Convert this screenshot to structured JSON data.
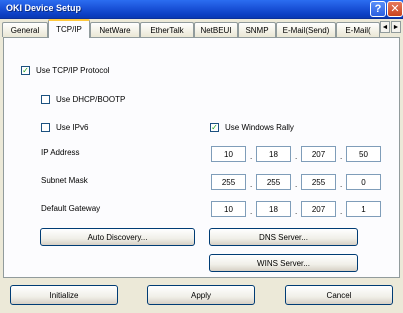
{
  "window": {
    "title": "OKI Device Setup",
    "help_glyph": "?",
    "close_glyph": "✕"
  },
  "tabs": [
    {
      "label": "General"
    },
    {
      "label": "TCP/IP",
      "active": true
    },
    {
      "label": "NetWare"
    },
    {
      "label": "EtherTalk"
    },
    {
      "label": "NetBEUI"
    },
    {
      "label": "SNMP"
    },
    {
      "label": "E-Mail(Send)"
    },
    {
      "label": "E-Mail("
    }
  ],
  "tab_scroll": {
    "left": "◄",
    "right": "►"
  },
  "checkboxes": {
    "use_tcpip": {
      "label": "Use TCP/IP Protocol",
      "checked": true,
      "mark": "✓"
    },
    "use_dhcp": {
      "label": "Use DHCP/BOOTP",
      "checked": false,
      "mark": ""
    },
    "use_ipv6": {
      "label": "Use IPv6",
      "checked": false,
      "mark": ""
    },
    "use_rally": {
      "label": "Use Windows Rally",
      "checked": true,
      "mark": "✓"
    }
  },
  "fields": {
    "ip_address": {
      "label": "IP Address",
      "octets": [
        "10",
        "18",
        "207",
        "50"
      ]
    },
    "subnet_mask": {
      "label": "Subnet Mask",
      "octets": [
        "255",
        "255",
        "255",
        "0"
      ]
    },
    "default_gateway": {
      "label": "Default Gateway",
      "octets": [
        "10",
        "18",
        "207",
        "1"
      ]
    },
    "dot": "."
  },
  "buttons": {
    "auto_discovery": "Auto Discovery...",
    "dns_server": "DNS Server...",
    "wins_server": "WINS Server..."
  },
  "footer": {
    "initialize": "Initialize",
    "apply": "Apply",
    "cancel": "Cancel"
  },
  "colors": {
    "title_bar": "#0c3fc4",
    "dialog_bg": "#ece9d8",
    "panel_bg": "#fcfcfe",
    "active_tab_accent": "#ffc83c",
    "check_mark": "#21a121"
  },
  "icons": {
    "help": "help-icon",
    "close": "close-icon",
    "tab_left": "chevron-left-icon",
    "tab_right": "chevron-right-icon",
    "check": "check-icon"
  }
}
